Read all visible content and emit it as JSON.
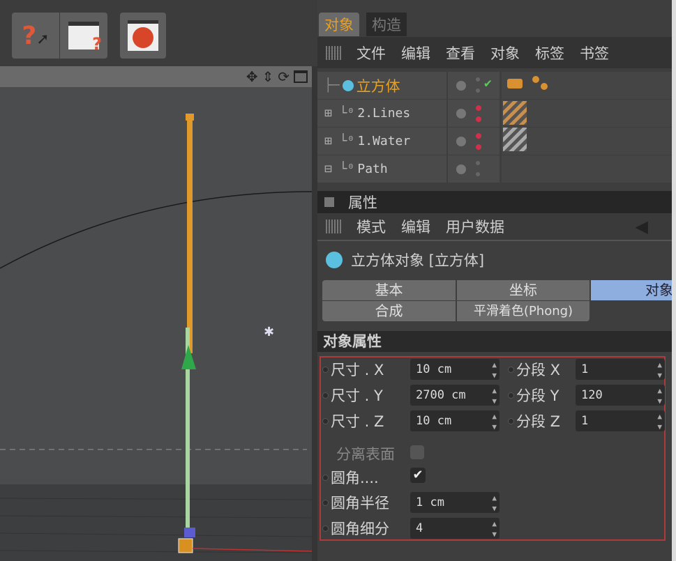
{
  "toolbar": {
    "icons": [
      "help-cursor-icon",
      "help-table-icon",
      "web-globe-icon"
    ]
  },
  "viewport": {
    "nav_icons": [
      "move-icon",
      "zoom-icon",
      "rotate-icon",
      "maximize-icon"
    ]
  },
  "objects_panel": {
    "tabs": [
      {
        "label": "对象",
        "active": true
      },
      {
        "label": "构造",
        "active": false
      }
    ],
    "menu": [
      "文件",
      "编辑",
      "查看",
      "对象",
      "标签",
      "书签"
    ],
    "rows": [
      {
        "name": "立方体",
        "selected": true
      },
      {
        "name": "2.Lines"
      },
      {
        "name": "1.Water"
      },
      {
        "name": "Path"
      }
    ]
  },
  "attributes_panel": {
    "title": "属性",
    "menu": [
      "模式",
      "编辑",
      "用户数据"
    ],
    "object_title": "立方体对象 [立方体]",
    "tabs": [
      {
        "label": "基本"
      },
      {
        "label": "坐标"
      },
      {
        "label": "对象",
        "active": true
      },
      {
        "label": "合成"
      },
      {
        "label": "平滑着色(Phong)"
      }
    ],
    "section": "对象属性",
    "fields": {
      "size_x": {
        "label": "尺寸 . X",
        "value": "10 cm"
      },
      "size_y": {
        "label": "尺寸 . Y",
        "value": "2700 cm"
      },
      "size_z": {
        "label": "尺寸 . Z",
        "value": "10 cm"
      },
      "seg_x": {
        "label": "分段 X",
        "value": "1"
      },
      "seg_y": {
        "label": "分段 Y",
        "value": "120"
      },
      "seg_z": {
        "label": "分段 Z",
        "value": "1"
      },
      "separate_surfaces": {
        "label": "分离表面",
        "checked": false
      },
      "fillet": {
        "label": "圆角....",
        "checked": true
      },
      "fillet_radius": {
        "label": "圆角半径",
        "value": "1 cm"
      },
      "fillet_subdivision": {
        "label": "圆角细分",
        "value": "4"
      }
    },
    "highlight_color": "#b03a3a"
  }
}
